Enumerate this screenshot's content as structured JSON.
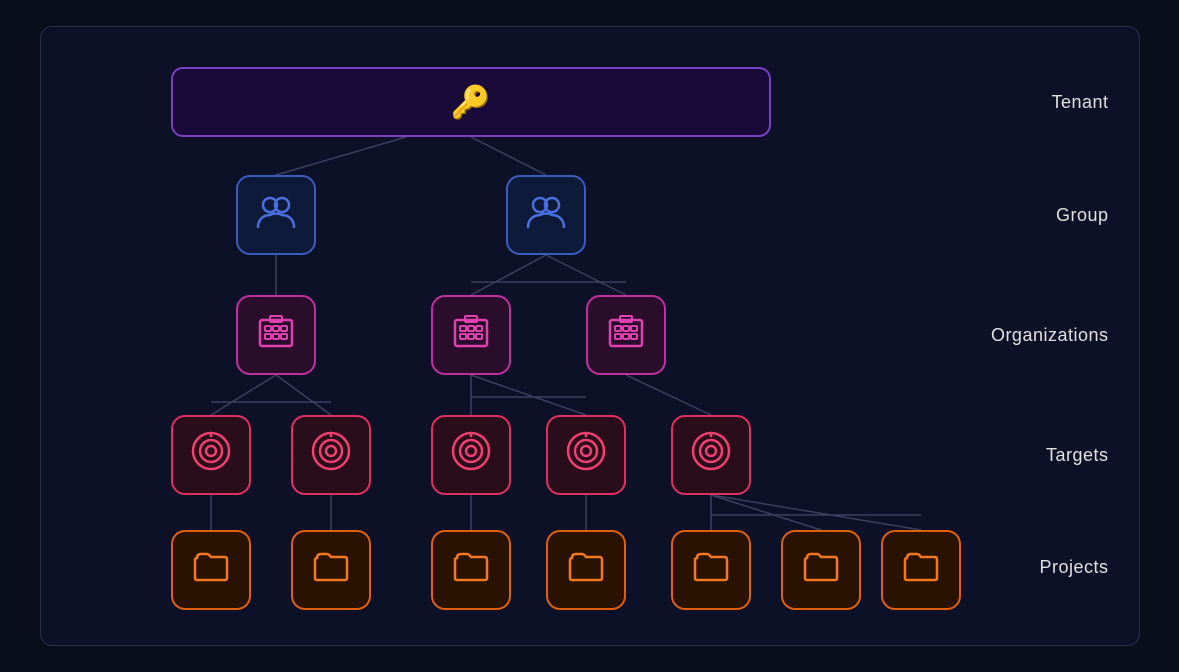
{
  "labels": {
    "tenant": "Tenant",
    "group": "Group",
    "organizations": "Organizations",
    "targets": "Targets",
    "projects": "Projects"
  },
  "icons": {
    "tenant": "🔑",
    "group": "👥",
    "org": "🏢",
    "target": "🎯",
    "project": "📁"
  },
  "colors": {
    "bg": "#0a0d1a",
    "border": "#2a2f4a",
    "tenant_border": "#7b3fc4",
    "group_border": "#3a5cbf",
    "org_border": "#c030a0",
    "target_border": "#e03060",
    "project_border": "#e06010"
  }
}
